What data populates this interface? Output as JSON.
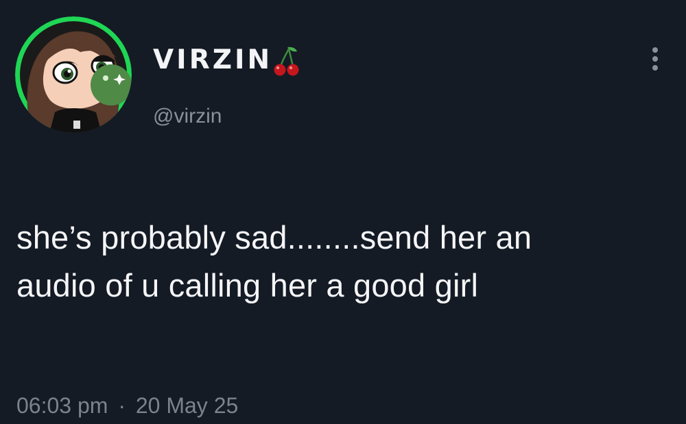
{
  "author": {
    "display_name": "VIRZIN",
    "name_emoji_icon": "cherry-icon",
    "handle": "@virzin",
    "avatar_icon": "cartoon-girl-bubblegum-avatar",
    "avatar_ring_color": "#1fd655"
  },
  "actions": {
    "more_icon": "vertical-ellipsis-icon"
  },
  "tweet": {
    "line1": "she’s probably sad........send her an",
    "line2": "audio of u calling her a good girl"
  },
  "meta": {
    "time": "06:03 pm",
    "separator": "·",
    "date": "20 May 25"
  },
  "colors": {
    "background": "#141b25",
    "text": "#f5f5f7",
    "muted": "#8a919b"
  }
}
